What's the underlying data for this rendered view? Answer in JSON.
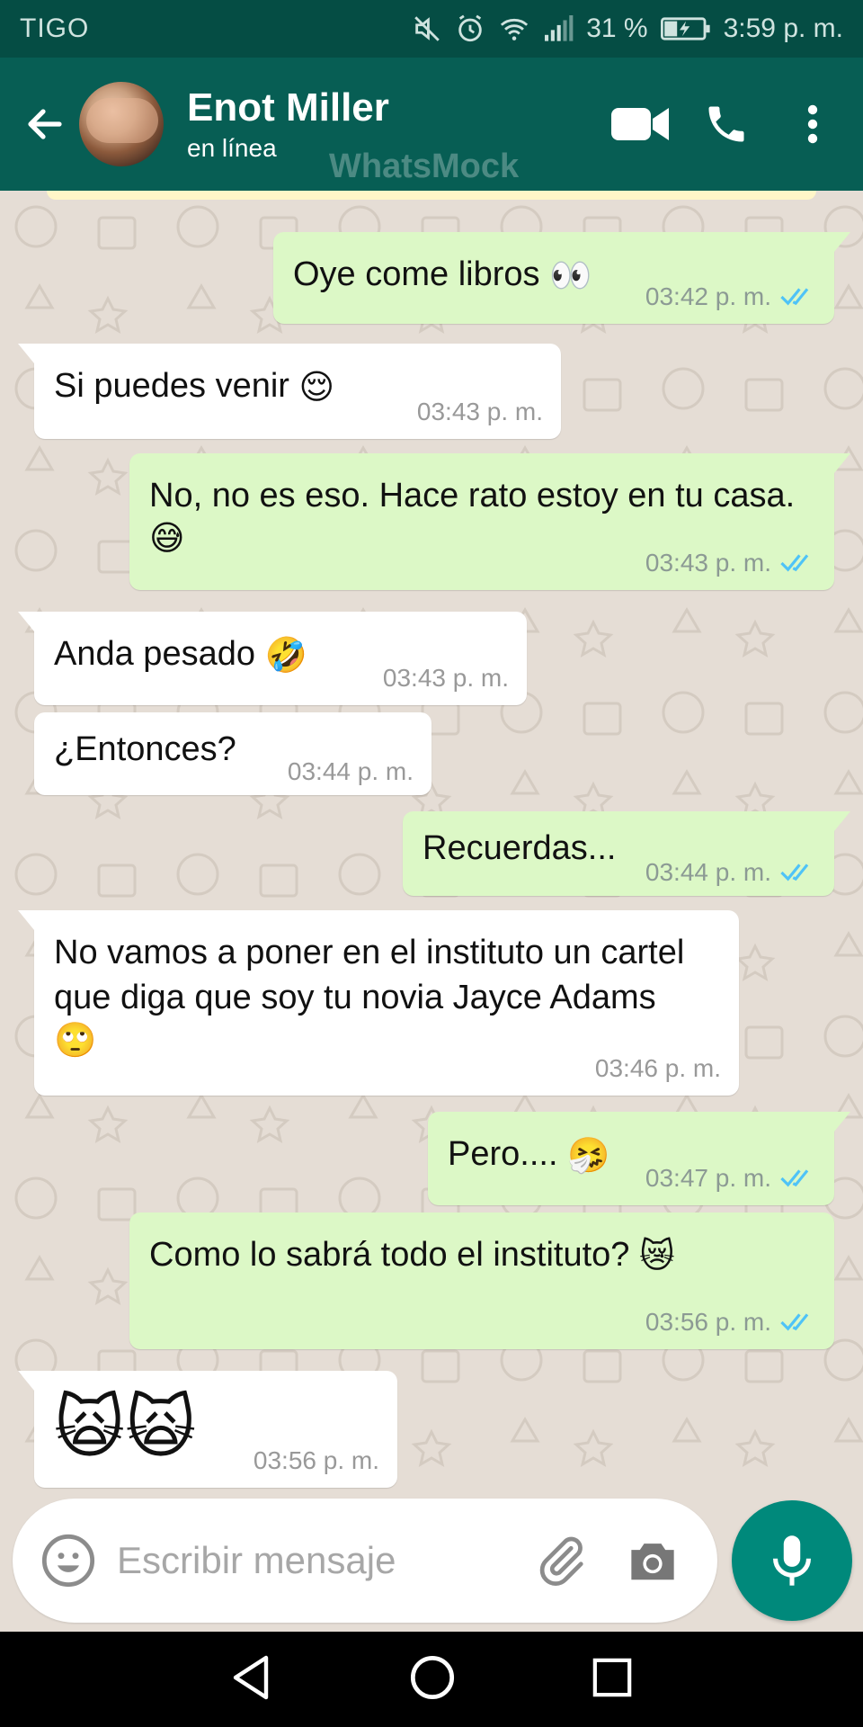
{
  "status_bar": {
    "carrier": "TIGO",
    "battery_percent": "31 %",
    "time": "3:59 p. m.",
    "icons": [
      "mute-icon",
      "alarm-icon",
      "wifi-icon",
      "signal-icon",
      "battery-charging-icon"
    ]
  },
  "header": {
    "contact_name": "Enot Miller",
    "contact_status": "en línea",
    "watermark": "WhatsMock",
    "icons": [
      "back-arrow-icon",
      "video-call-icon",
      "phone-icon",
      "more-options-icon"
    ]
  },
  "messages": [
    {
      "direction": "out",
      "text": "Oye come libros",
      "emoji": "👀",
      "time": "03:42 p. m.",
      "status": "read"
    },
    {
      "direction": "in",
      "text": "Si puedes venir",
      "emoji": "😌",
      "time": "03:43 p. m."
    },
    {
      "direction": "out",
      "text": "No, no es eso. Hace rato estoy en tu casa.",
      "emoji": "😅",
      "time": "03:43 p. m.",
      "status": "read"
    },
    {
      "direction": "in",
      "text": "Anda pesado",
      "emoji": "🤣",
      "time": "03:43 p. m."
    },
    {
      "direction": "in",
      "text": "¿Entonces?",
      "emoji": "",
      "time": "03:44 p. m."
    },
    {
      "direction": "out",
      "text": "Recuerdas...",
      "emoji": "",
      "time": "03:44 p. m.",
      "status": "read"
    },
    {
      "direction": "in",
      "text": "No vamos a poner en el instituto un cartel que diga que soy tu novia Jayce Adams",
      "emoji": "🙄",
      "time": "03:46 p. m."
    },
    {
      "direction": "out",
      "text": "Pero....",
      "emoji": "🤧",
      "time": "03:47 p. m.",
      "status": "read"
    },
    {
      "direction": "out",
      "text": "Como lo sabrá todo el instituto?",
      "emoji": "😿",
      "time": "03:56 p. m.",
      "status": "read"
    },
    {
      "direction": "in",
      "text": "",
      "emoji": "🙀🙀",
      "time": "03:56 p. m."
    }
  ],
  "composer": {
    "placeholder": "Escribir mensaje",
    "icons": [
      "emoji-icon",
      "attach-icon",
      "camera-icon",
      "mic-icon"
    ]
  },
  "nav_bar": {
    "icons": [
      "nav-back-icon",
      "nav-home-icon",
      "nav-recents-icon"
    ]
  },
  "colors": {
    "status_bar_bg": "#054d44",
    "header_bg": "#075e54",
    "chat_bg": "#e5ddd5",
    "outgoing_bubble": "#dcf8c6",
    "incoming_bubble": "#ffffff",
    "read_ticks": "#4fc3f7",
    "mic_button": "#00897b"
  }
}
